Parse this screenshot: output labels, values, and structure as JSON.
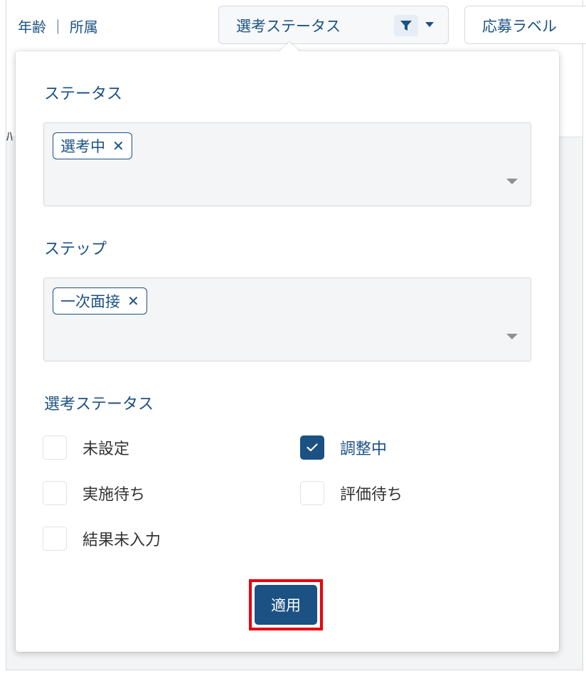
{
  "header": {
    "age_dept_label": "年齢 ｜ 所属",
    "status_column_label": "選考ステータス",
    "label_column_label": "応募ラベル",
    "row_sliver_text": "ﾊ"
  },
  "popover": {
    "status_section": {
      "title": "ステータス",
      "selected_chips": [
        "選考中"
      ]
    },
    "step_section": {
      "title": "ステップ",
      "selected_chips": [
        "一次面接"
      ]
    },
    "selection_status_section": {
      "title": "選考ステータス",
      "options": [
        {
          "label": "未設定",
          "checked": false
        },
        {
          "label": "調整中",
          "checked": true
        },
        {
          "label": "実施待ち",
          "checked": false
        },
        {
          "label": "評価待ち",
          "checked": false
        },
        {
          "label": "結果未入力",
          "checked": false
        }
      ]
    },
    "apply_label": "適用"
  },
  "chip_remove_glyph": "✕",
  "colors": {
    "primary": "#1b5183",
    "highlight_border": "#e8000d",
    "field_bg": "#f4f5f6"
  },
  "icons": {
    "filter": "filter-icon",
    "caret": "caret-down-icon",
    "check": "check-icon"
  }
}
